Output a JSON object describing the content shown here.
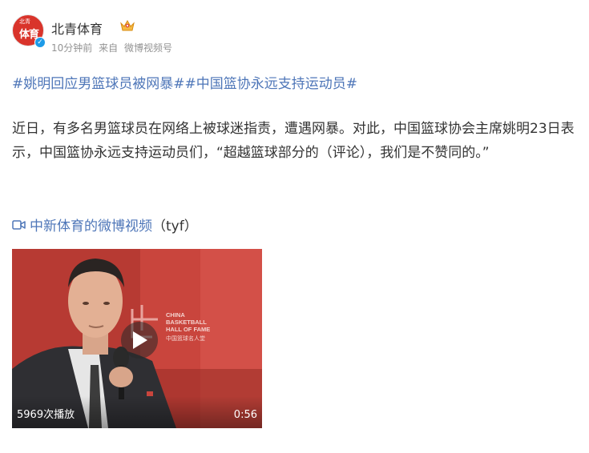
{
  "post": {
    "author": "北青体育",
    "meta": {
      "time": "10分钟前",
      "source_prefix": "来自",
      "source": "微博视频号"
    },
    "topic": "#姚明回应男篮球员被网暴##中国篮协永远支持运动员#",
    "text": "近日，有多名男篮球员在网络上被球迷指责，遭遇网暴。对此，中国篮球协会主席姚明23日表示，中国篮协永远支持运动员们，“超越篮球部分的（评论），我们是不赞同的。”",
    "video_link": {
      "label": "中新体育的微博视频",
      "suffix": "（tyf）"
    },
    "video": {
      "views": "5969次播放",
      "duration": "0:56",
      "backdrop_text": {
        "line1": "CHINA",
        "line2": "BASKETBALL",
        "line3": "HALL OF FAME",
        "line4": "中国篮球名人堂"
      }
    },
    "avatar_text": {
      "top": "北青",
      "main": "体育"
    }
  },
  "colors": {
    "link": "#4e76b8",
    "text": "#333333",
    "meta": "#939393",
    "verify": "#1e9be8",
    "avatar_bg": "#d9342b"
  },
  "icons": {
    "verified": "verified-badge-icon",
    "member": "crown-icon",
    "video": "video-camera-icon",
    "play": "play-icon"
  }
}
